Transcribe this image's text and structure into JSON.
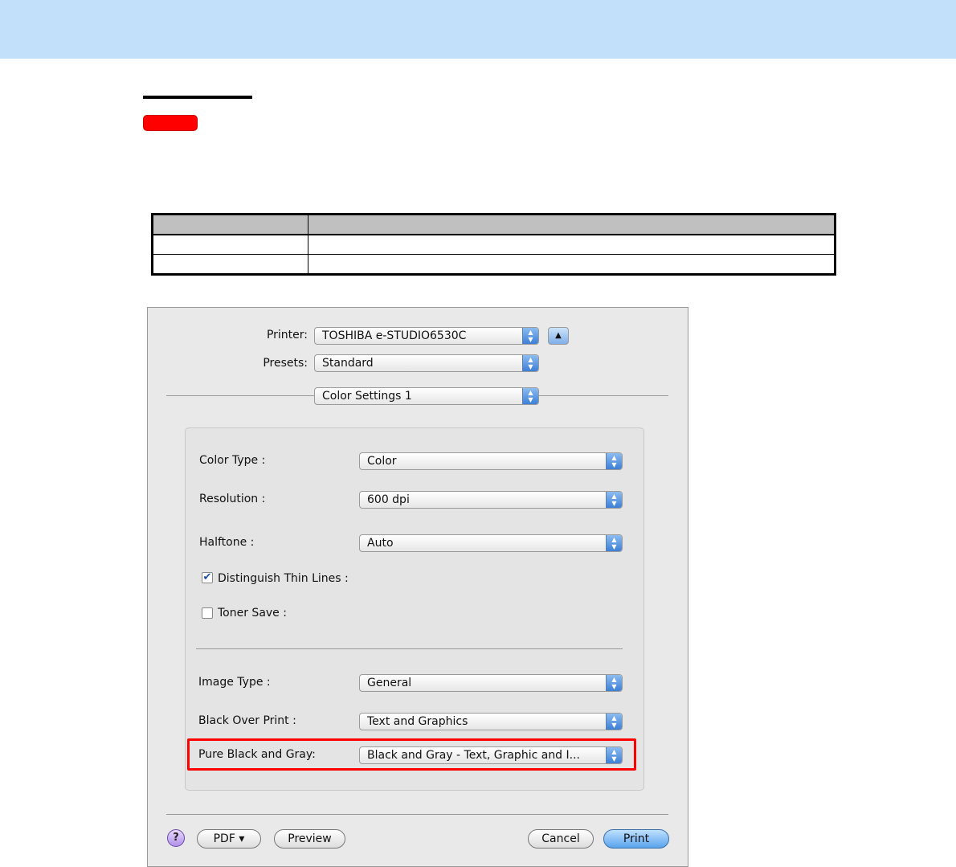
{
  "dialog": {
    "printer_label": "Printer:",
    "printer_value": "TOSHIBA e-STUDIO6530C",
    "presets_label": "Presets:",
    "presets_value": "Standard",
    "panel_value": "Color Settings 1",
    "color_type_label": "Color Type :",
    "color_type_value": "Color",
    "resolution_label": "Resolution :",
    "resolution_value": "600 dpi",
    "halftone_label": "Halftone :",
    "halftone_value": "Auto",
    "thin_lines_label": "Distinguish Thin Lines :",
    "thin_lines_checked": true,
    "toner_save_label": "Toner Save :",
    "toner_save_checked": false,
    "image_type_label": "Image Type :",
    "image_type_value": "General",
    "black_over_print_label": "Black Over Print :",
    "black_over_print_value": "Text and Graphics",
    "pure_black_label": "Pure Black and Gray:",
    "pure_black_value": "Black and Gray - Text, Graphic and I...",
    "help": "?",
    "pdf": "PDF ▾",
    "preview": "Preview",
    "cancel": "Cancel",
    "print": "Print"
  },
  "colors": {
    "highlight": "#ff0000",
    "header": "#c2e0fa"
  }
}
